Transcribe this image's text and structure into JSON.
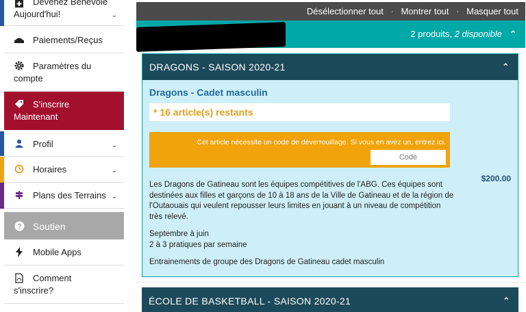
{
  "sidebar": {
    "items": [
      {
        "label": "Devenez Bénévole Aujourd'hui!",
        "icon": "user-plus-icon",
        "chevron": "⌄"
      },
      {
        "label": "Paiements/Reçus",
        "icon": "money-icon"
      },
      {
        "label": "Paramètres du compte",
        "icon": "gear-icon"
      },
      {
        "label": "S'inscrire Maintenant",
        "icon": "tag-icon"
      },
      {
        "label": "Profil",
        "icon": "person-icon",
        "chevron": "⌄"
      },
      {
        "label": "Horaires",
        "icon": "clock-icon",
        "chevron": "⌄"
      },
      {
        "label": "Plans des Terrains",
        "icon": "signpost-icon",
        "chevron": "⌄"
      },
      {
        "label": "Soutien",
        "icon": "question-icon"
      },
      {
        "label": "Mobile Apps",
        "icon": "bolt-icon"
      },
      {
        "label": "Comment s'inscrire?",
        "icon": "pdf-icon"
      }
    ],
    "colors": {
      "active": "#a3102e",
      "section": "#a8a8a8",
      "accent_blue": "#2456a6",
      "accent_orange": "#f0a30a",
      "accent_purple": "#6c2a8c"
    }
  },
  "toolbar": {
    "deselect": "Désélectionner tout",
    "sep": "·",
    "show": "Montrer tout",
    "hide": "Masquer tout"
  },
  "summary": {
    "products": "2 produits,",
    "available": "2 disponible"
  },
  "panel1": {
    "header": "DRAGONS - SAISON 2020-21",
    "title": "Dragons - Cadet masculin",
    "remaining": "* 16 article(s) restants",
    "unlock_message": "Cet article nécessite un code de déverrouillage. Si vous en avez un, entrez ici.",
    "code_placeholder": "Code",
    "price": "$200.00",
    "description": "Les Dragons de Gatineau sont les équipes compétitives de l'ABG. Ces équipes sont destinées aux filles et garçons de 10 à 18 ans de la Ville de Gatineau et de la région de l'Outaouais qui veulent repousser leurs limites en jouant à un niveau de compétition très relevé.",
    "schedule_line1": "Septembre à juin",
    "schedule_line2": "2 à 3 pratiques par semaine",
    "training": "Entrainements de groupe des Dragons de Gatineau cadet masculin"
  },
  "panel2": {
    "header": "ÉCOLE DE BASKETBALL - SAISON 2020-21"
  },
  "icons": {
    "caret_up": "⌃"
  },
  "colors": {
    "toolbar": "#4b4b4b",
    "teal": "#00a8a8",
    "panel_head": "#1d4a5a",
    "panel_bg": "#cfeff8",
    "title_blue": "#1f6aa0",
    "remaining": "#e0a020",
    "unlock": "#f0a30a"
  }
}
